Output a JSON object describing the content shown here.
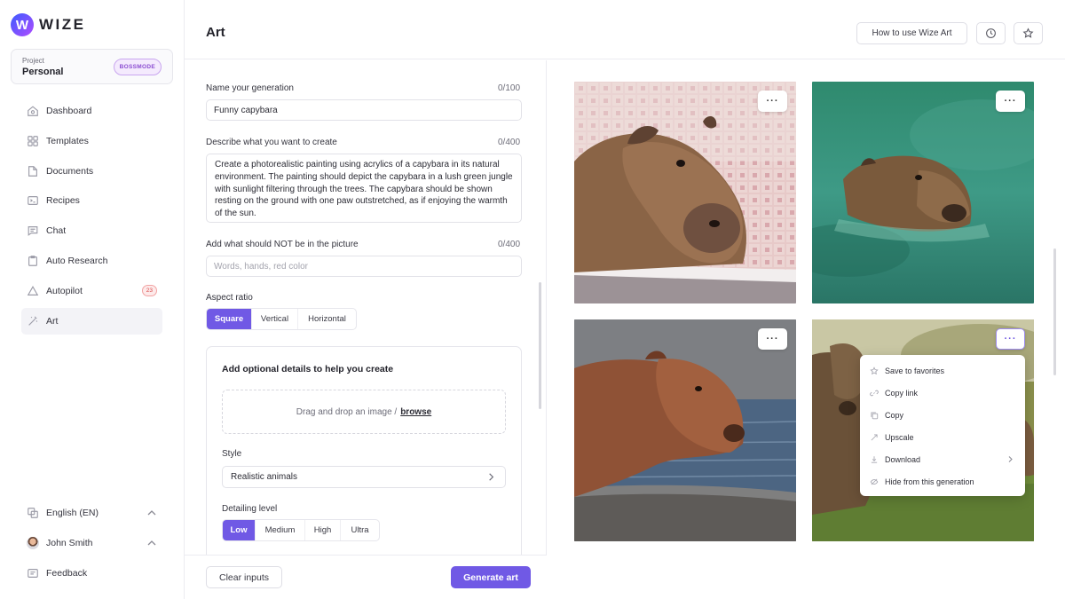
{
  "brand": {
    "logo_letter": "W",
    "name": "WIZE"
  },
  "project": {
    "label": "Project",
    "name": "Personal",
    "badge": "BOSSMODE"
  },
  "nav": [
    {
      "label": "Dashboard",
      "icon": "home-icon"
    },
    {
      "label": "Templates",
      "icon": "grid-icon"
    },
    {
      "label": "Documents",
      "icon": "document-icon"
    },
    {
      "label": "Recipes",
      "icon": "terminal-icon"
    },
    {
      "label": "Chat",
      "icon": "chat-icon"
    },
    {
      "label": "Auto Research",
      "icon": "clipboard-icon"
    },
    {
      "label": "Autopilot",
      "icon": "triangle-icon",
      "badge": "23"
    },
    {
      "label": "Art",
      "icon": "magic-wand-icon",
      "active": true
    }
  ],
  "bottom_nav": {
    "language": "English (EN)",
    "user": "John Smith",
    "feedback": "Feedback"
  },
  "header": {
    "title": "Art",
    "how_to": "How to use Wize Art"
  },
  "form": {
    "name": {
      "label": "Name your generation",
      "counter": "0/100",
      "value": "Funny capybara"
    },
    "describe": {
      "label": "Describe what you want to create",
      "counter": "0/400",
      "value": "Create a photorealistic painting using acrylics of a capybara in its natural environment. The painting should depict the capybara in a lush green jungle with sunlight filtering through the trees. The capybara should be shown resting on the ground with one paw outstretched, as if enjoying the warmth of the sun."
    },
    "negative": {
      "label": "Add what should NOT be in the picture",
      "counter": "0/400",
      "placeholder": "Words, hands, red color"
    },
    "aspect": {
      "label": "Aspect ratio",
      "options": [
        "Square",
        "Vertical",
        "Horizontal"
      ],
      "selected": "Square"
    },
    "details": {
      "title": "Add optional details to help you create",
      "drop_text": "Drag and drop an image /",
      "browse": "browse",
      "style_label": "Style",
      "style_value": "Realistic animals",
      "detail_label": "Detailing level",
      "detail_options": [
        "Low",
        "Medium",
        "High",
        "Ultra"
      ],
      "detail_selected": "Low"
    },
    "clear_button": "Clear inputs",
    "generate_button": "Generate art"
  },
  "gallery": {
    "more_label": "···",
    "menu": [
      {
        "label": "Save to favorites",
        "icon": "star-icon"
      },
      {
        "label": "Copy link",
        "icon": "link-icon"
      },
      {
        "label": "Copy",
        "icon": "copy-icon"
      },
      {
        "label": "Upscale",
        "icon": "upscale-icon"
      },
      {
        "label": "Download",
        "icon": "download-icon",
        "submenu": true
      },
      {
        "label": "Hide from this generation",
        "icon": "hide-icon"
      }
    ]
  },
  "colors": {
    "accent": "#7059e5",
    "badge_red": "#d94b4b",
    "bossmode": "#8a4cd1"
  }
}
